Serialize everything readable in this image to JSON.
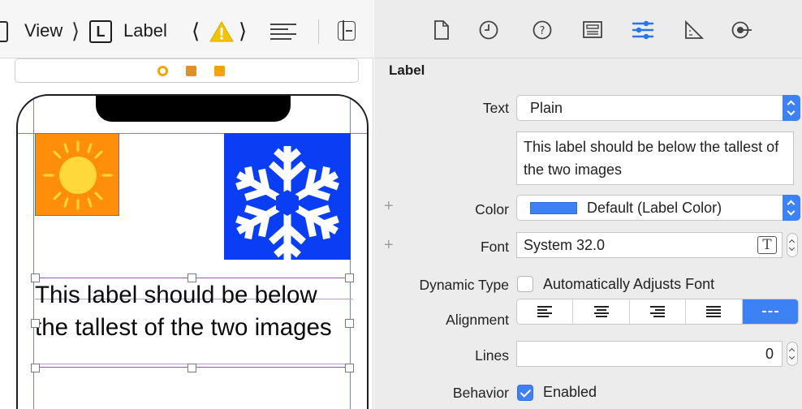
{
  "jump_bar": {
    "items": [
      "View",
      "Label"
    ],
    "separator": "⟩",
    "label_symbol": "L",
    "prev": "⟨",
    "next": "⟩"
  },
  "canvas": {
    "label_text": "This label should be below the tallest of the two images",
    "colors": {
      "sun_background": "#ff8f0a",
      "snow_background": "#0a3ef5",
      "safe_area": "#6b86d8"
    }
  },
  "inspector": {
    "tab_icons": [
      "file-icon",
      "history-icon",
      "help-icon",
      "identity-icon",
      "attributes-icon",
      "size-icon",
      "connections-icon"
    ],
    "section_title": "Label",
    "text_label": "Text",
    "text_type": "Plain",
    "text_value": "This label should be below the tallest of the two images",
    "color_label": "Color",
    "color_value": "Default (Label Color)",
    "color_swatch": "#3c82f6",
    "font_label": "Font",
    "font_value": "System 32.0",
    "font_picker_symbol": "T",
    "dynamic_type_label": "Dynamic Type",
    "dynamic_type_option": "Automatically Adjusts Font",
    "dynamic_type_checked": false,
    "alignment_label": "Alignment",
    "alignment_options": [
      "left",
      "center",
      "right",
      "justified",
      "natural"
    ],
    "alignment_selected": "natural",
    "lines_label": "Lines",
    "lines_value": "0",
    "behavior_label": "Behavior",
    "behavior_option": "Enabled",
    "behavior_checked": true,
    "plus_symbol": "+"
  }
}
